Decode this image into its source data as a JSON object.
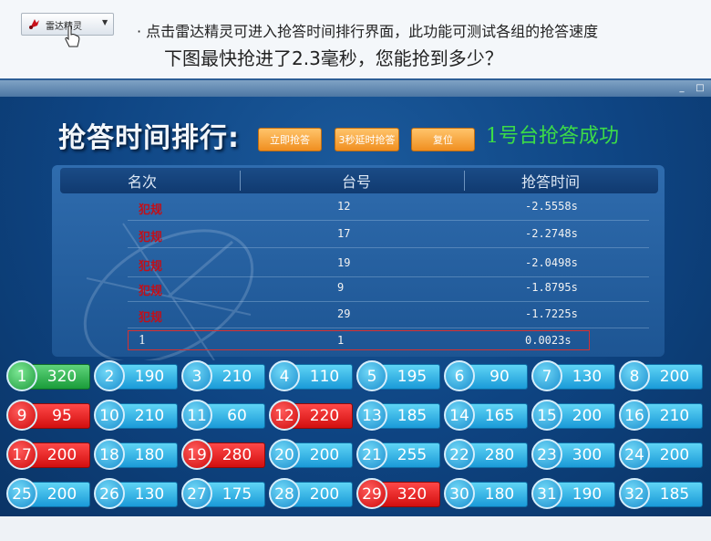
{
  "toolbar": {
    "radar_label": "雷达精灵",
    "radar_icon": "radar-icon",
    "dropdown_icon": "chevron-down-icon"
  },
  "instructions": {
    "line1": "· 点击雷达精灵可进入抢答时间排行界面，此功能可测试各组的抢答速度",
    "line2": "下图最快抢进了2.3毫秒，您能抢到多少？"
  },
  "window": {
    "minimize": "_",
    "maximize": "□"
  },
  "app": {
    "title": "抢答时间排行:",
    "buttons": {
      "immediate": "立即抢答",
      "delay3": "3秒延时抢答",
      "reset": "复位"
    },
    "status": "1号台抢答成功",
    "table": {
      "headers": {
        "rank": "名次",
        "desk": "台号",
        "time": "抢答时间"
      },
      "rows": [
        {
          "rank": "犯规",
          "desk": "12",
          "time": "-2.5558s",
          "foul": true
        },
        {
          "rank": "犯规",
          "desk": "17",
          "time": "-2.2748s",
          "foul": true
        },
        {
          "rank": "犯规",
          "desk": "19",
          "time": "-2.0498s",
          "foul": true
        },
        {
          "rank": "犯规",
          "desk": "9",
          "time": "-1.8795s",
          "foul": true
        },
        {
          "rank": "犯规",
          "desk": "29",
          "time": "-1.7225s",
          "foul": true
        },
        {
          "rank": "1",
          "desk": "1",
          "time": "0.0023s",
          "foul": false
        }
      ]
    }
  },
  "desks": [
    {
      "n": "1",
      "v": "320",
      "state": "green"
    },
    {
      "n": "2",
      "v": "190",
      "state": "blue"
    },
    {
      "n": "3",
      "v": "210",
      "state": "blue"
    },
    {
      "n": "4",
      "v": "110",
      "state": "blue"
    },
    {
      "n": "5",
      "v": "195",
      "state": "blue"
    },
    {
      "n": "6",
      "v": "90",
      "state": "blue"
    },
    {
      "n": "7",
      "v": "130",
      "state": "blue"
    },
    {
      "n": "8",
      "v": "200",
      "state": "blue"
    },
    {
      "n": "9",
      "v": "95",
      "state": "red"
    },
    {
      "n": "10",
      "v": "210",
      "state": "blue"
    },
    {
      "n": "11",
      "v": "60",
      "state": "blue"
    },
    {
      "n": "12",
      "v": "220",
      "state": "red"
    },
    {
      "n": "13",
      "v": "185",
      "state": "blue"
    },
    {
      "n": "14",
      "v": "165",
      "state": "blue"
    },
    {
      "n": "15",
      "v": "200",
      "state": "blue"
    },
    {
      "n": "16",
      "v": "210",
      "state": "blue"
    },
    {
      "n": "17",
      "v": "200",
      "state": "red"
    },
    {
      "n": "18",
      "v": "180",
      "state": "blue"
    },
    {
      "n": "19",
      "v": "280",
      "state": "red"
    },
    {
      "n": "20",
      "v": "200",
      "state": "blue"
    },
    {
      "n": "21",
      "v": "255",
      "state": "blue"
    },
    {
      "n": "22",
      "v": "280",
      "state": "blue"
    },
    {
      "n": "23",
      "v": "300",
      "state": "blue"
    },
    {
      "n": "24",
      "v": "200",
      "state": "blue"
    },
    {
      "n": "25",
      "v": "200",
      "state": "blue"
    },
    {
      "n": "26",
      "v": "130",
      "state": "blue"
    },
    {
      "n": "27",
      "v": "175",
      "state": "blue"
    },
    {
      "n": "28",
      "v": "200",
      "state": "blue"
    },
    {
      "n": "29",
      "v": "320",
      "state": "red"
    },
    {
      "n": "30",
      "v": "180",
      "state": "blue"
    },
    {
      "n": "31",
      "v": "190",
      "state": "blue"
    },
    {
      "n": "32",
      "v": "185",
      "state": "blue"
    }
  ],
  "colors": {
    "window_bg": "#0c3f76",
    "accent_orange": "#f08f20",
    "success_green": "#3cdc47",
    "foul_red": "#c0101a",
    "tile_blue": "#1a9ad8",
    "tile_red": "#d20f0f",
    "tile_green": "#1a9c3a"
  }
}
